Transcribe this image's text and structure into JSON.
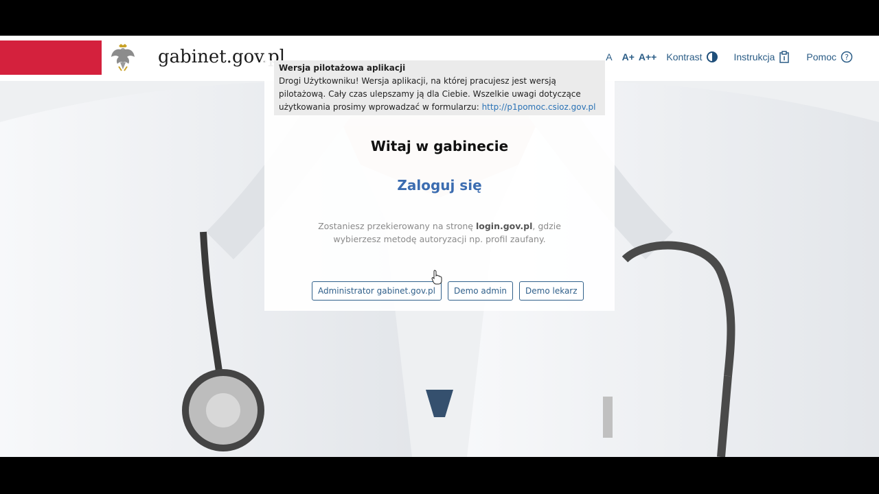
{
  "header": {
    "site_title": "gabinet.gov.pl",
    "brand_color": "#d4213d",
    "nav": {
      "font_a": "A",
      "font_a_plus": "A+",
      "font_a_plusplus": "A++",
      "contrast": "Kontrast",
      "instructions": "Instrukcja",
      "help": "Pomoc"
    }
  },
  "notice": {
    "title": "Wersja pilotażowa aplikacji",
    "body": "Drogi Użytkowniku! Wersja aplikacji, na której pracujesz jest wersją pilotażową. Cały czas ulepszamy ją dla Ciebie. Wszelkie uwagi dotyczące użytkowania prosimy wprowadzać w formularzu: ",
    "link": "http://p1pomoc.csioz.gov.pl"
  },
  "main": {
    "welcome": "Witaj w gabinecie",
    "login": "Zaloguj się",
    "redirect_pre": "Zostaniesz przekierowany na stronę ",
    "redirect_bold": "login.gov.pl",
    "redirect_post": ", gdzie wybierzesz metodę autoryzacji np. profil zaufany."
  },
  "buttons": {
    "admin": "Administrator gabinet.gov.pl",
    "demo_admin": "Demo admin",
    "demo_doctor": "Demo lekarz"
  },
  "icons": {
    "eagle": "polish-eagle-emblem",
    "contrast": "half-circle-contrast-icon",
    "instructions": "document-icon",
    "help": "question-circle-icon",
    "cursor": "hand-pointer-cursor"
  }
}
